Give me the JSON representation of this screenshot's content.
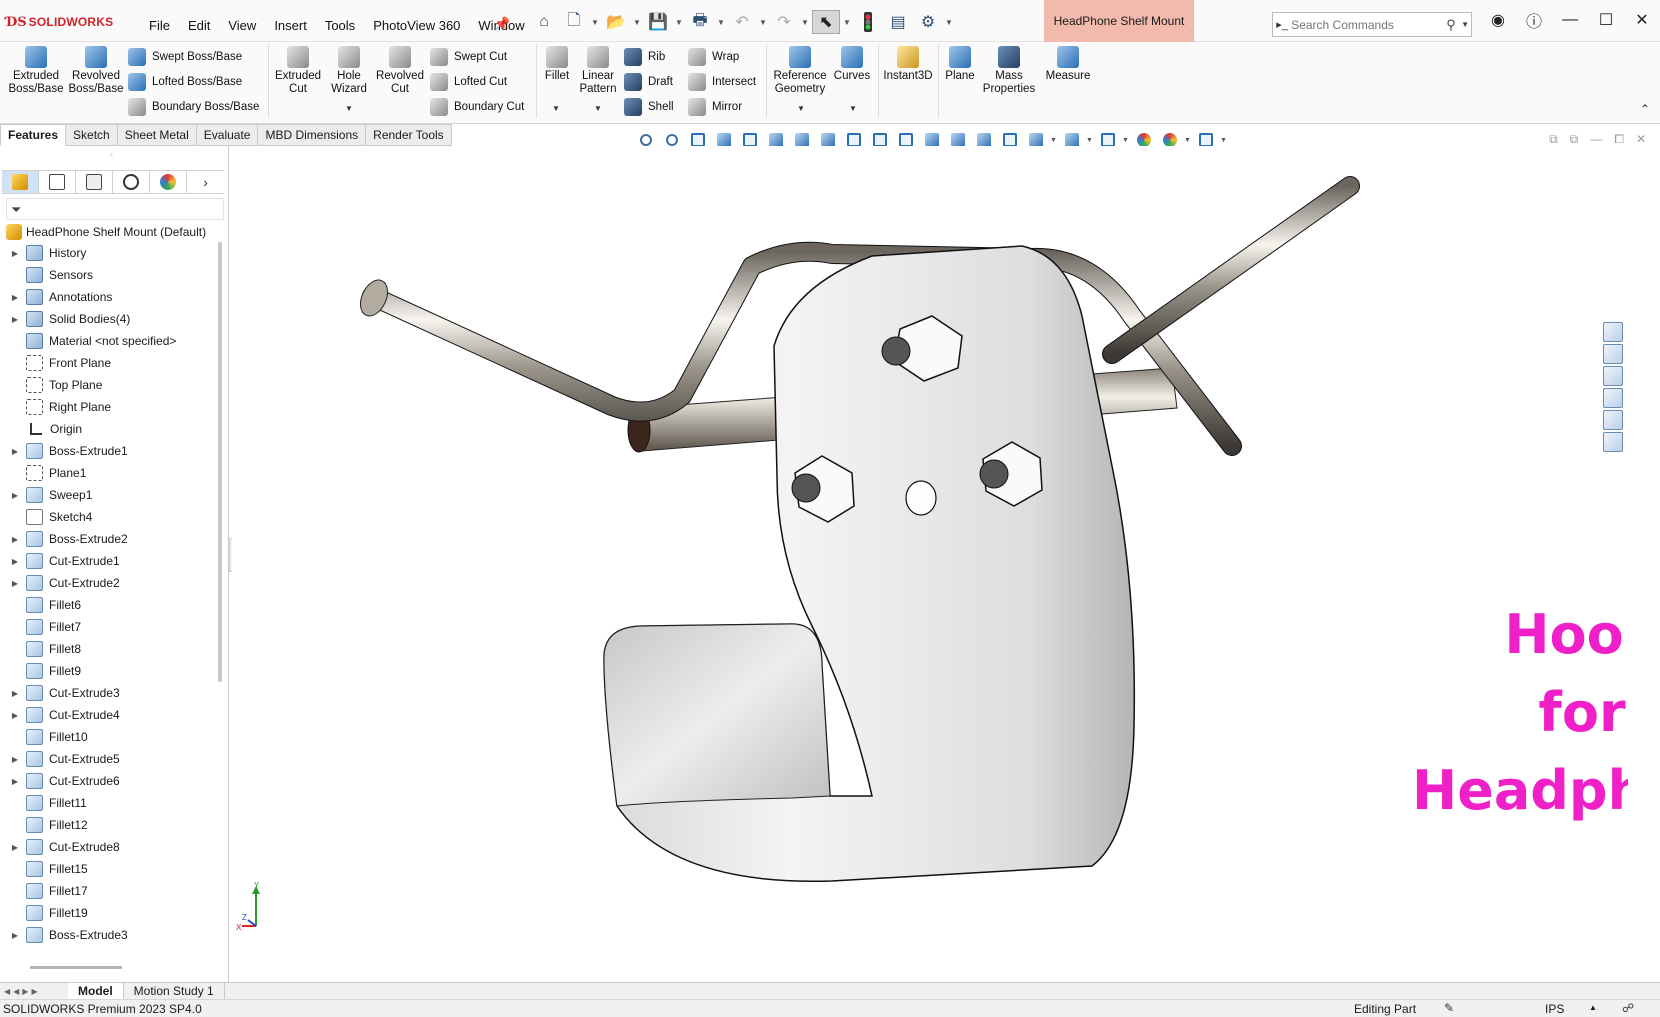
{
  "app": {
    "brand": "SOLIDWORKS",
    "document_title": "HeadPhone Shelf Mount",
    "menu": [
      "File",
      "Edit",
      "View",
      "Insert",
      "Tools",
      "PhotoView 360",
      "Window"
    ],
    "search_placeholder": "Search Commands"
  },
  "ribbon": {
    "extruded_boss": "Extruded Boss/Base",
    "revolved_boss": "Revolved Boss/Base",
    "swept_boss": "Swept Boss/Base",
    "lofted_boss": "Lofted Boss/Base",
    "boundary_boss": "Boundary Boss/Base",
    "extruded_cut": "Extruded Cut",
    "hole_wizard": "Hole Wizard",
    "revolved_cut": "Revolved Cut",
    "swept_cut": "Swept Cut",
    "lofted_cut": "Lofted Cut",
    "boundary_cut": "Boundary Cut",
    "fillet": "Fillet",
    "linear_pattern": "Linear Pattern",
    "rib": "Rib",
    "draft": "Draft",
    "shell": "Shell",
    "wrap": "Wrap",
    "intersect": "Intersect",
    "mirror": "Mirror",
    "reference_geometry": "Reference Geometry",
    "curves": "Curves",
    "instant3d": "Instant3D",
    "plane": "Plane",
    "mass_properties": "Mass Properties",
    "measure": "Measure"
  },
  "cm_tabs": [
    "Features",
    "Sketch",
    "Sheet Metal",
    "Evaluate",
    "MBD Dimensions",
    "Render Tools"
  ],
  "tree": {
    "root": "HeadPhone Shelf Mount  (Default)",
    "items": [
      {
        "label": "History",
        "expandable": true,
        "icon": "folder"
      },
      {
        "label": "Sensors",
        "expandable": false,
        "icon": "folder"
      },
      {
        "label": "Annotations",
        "expandable": true,
        "icon": "folder"
      },
      {
        "label": "Solid Bodies(4)",
        "expandable": true,
        "icon": "folder"
      },
      {
        "label": "Material <not specified>",
        "expandable": false,
        "icon": "folder"
      },
      {
        "label": "Front Plane",
        "expandable": false,
        "icon": "plane"
      },
      {
        "label": "Top Plane",
        "expandable": false,
        "icon": "plane"
      },
      {
        "label": "Right Plane",
        "expandable": false,
        "icon": "plane"
      },
      {
        "label": "Origin",
        "expandable": false,
        "icon": "origin"
      },
      {
        "label": "Boss-Extrude1",
        "expandable": true,
        "icon": "feature"
      },
      {
        "label": "Plane1",
        "expandable": false,
        "icon": "plane"
      },
      {
        "label": "Sweep1",
        "expandable": true,
        "icon": "feature"
      },
      {
        "label": "Sketch4",
        "expandable": false,
        "icon": "sketch"
      },
      {
        "label": "Boss-Extrude2",
        "expandable": true,
        "icon": "feature"
      },
      {
        "label": "Cut-Extrude1",
        "expandable": true,
        "icon": "feature"
      },
      {
        "label": "Cut-Extrude2",
        "expandable": true,
        "icon": "feature"
      },
      {
        "label": "Fillet6",
        "expandable": false,
        "icon": "feature"
      },
      {
        "label": "Fillet7",
        "expandable": false,
        "icon": "feature"
      },
      {
        "label": "Fillet8",
        "expandable": false,
        "icon": "feature"
      },
      {
        "label": "Fillet9",
        "expandable": false,
        "icon": "feature"
      },
      {
        "label": "Cut-Extrude3",
        "expandable": true,
        "icon": "feature"
      },
      {
        "label": "Cut-Extrude4",
        "expandable": true,
        "icon": "feature"
      },
      {
        "label": "Fillet10",
        "expandable": false,
        "icon": "feature"
      },
      {
        "label": "Cut-Extrude5",
        "expandable": true,
        "icon": "feature"
      },
      {
        "label": "Cut-Extrude6",
        "expandable": true,
        "icon": "feature"
      },
      {
        "label": "Fillet11",
        "expandable": false,
        "icon": "feature"
      },
      {
        "label": "Fillet12",
        "expandable": false,
        "icon": "feature"
      },
      {
        "label": "Cut-Extrude8",
        "expandable": true,
        "icon": "feature"
      },
      {
        "label": "Fillet15",
        "expandable": false,
        "icon": "feature"
      },
      {
        "label": "Fillet17",
        "expandable": false,
        "icon": "feature"
      },
      {
        "label": "Fillet19",
        "expandable": false,
        "icon": "feature"
      },
      {
        "label": "Boss-Extrude3",
        "expandable": true,
        "icon": "feature"
      }
    ]
  },
  "viewport": {
    "overlay_lines": [
      "Hook",
      "for",
      "Headphones"
    ],
    "overlay_color": "#f020c8",
    "triad_labels": {
      "x": "X",
      "y": "Y",
      "z": "Z"
    }
  },
  "bottom_tabs": [
    "Model",
    "Motion Study 1"
  ],
  "status": {
    "product": "SOLIDWORKS Premium 2023 SP4.0",
    "mode": "Editing Part",
    "units": "IPS"
  }
}
